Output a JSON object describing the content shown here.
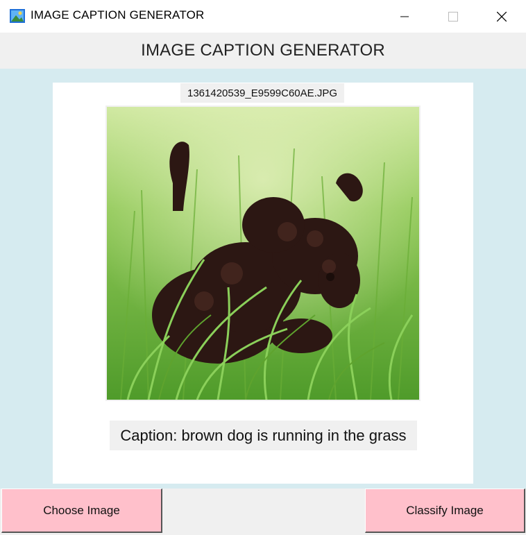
{
  "window": {
    "title": "IMAGE CAPTION GENERATOR",
    "icon": "photo-app-icon",
    "controls": [
      "minimize-icon",
      "maximize-icon",
      "close-icon"
    ]
  },
  "header": {
    "title": "IMAGE CAPTION GENERATOR"
  },
  "image_panel": {
    "filename": "1361420539_E9599C60AE.JPG",
    "caption": "Caption: brown dog is running in the grass"
  },
  "buttons": {
    "choose_label": "Choose Image",
    "classify_label": "Classify Image"
  },
  "colors": {
    "panel_bg": "#d6ebf0",
    "button_bg": "#ffc0cb",
    "chrome_bg": "#f0f0f0"
  }
}
